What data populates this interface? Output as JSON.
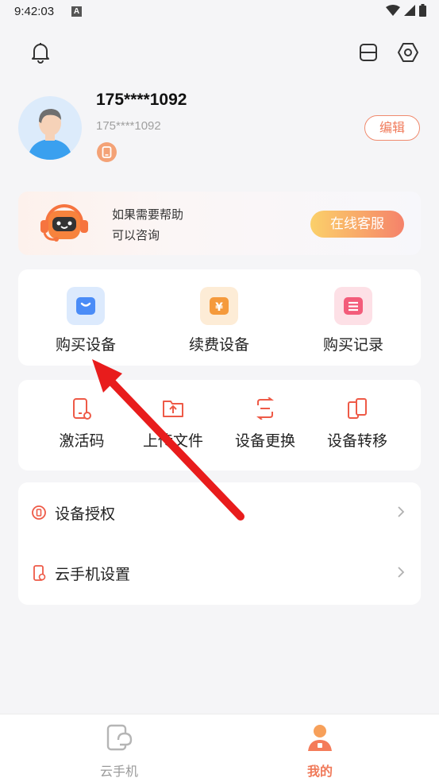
{
  "status": {
    "time": "9:42:03",
    "notif_letter": "A"
  },
  "header": {
    "icons": [
      "bell-icon",
      "scan-icon",
      "settings-icon"
    ]
  },
  "profile": {
    "name": "175****1092",
    "phone": "175****1092",
    "edit_label": "编辑"
  },
  "help": {
    "line1": "如果需要帮助",
    "line2": "可以咨询",
    "button": "在线客服"
  },
  "grid1": [
    {
      "label": "购买设备",
      "icon": "bag-icon",
      "color": "#4a8cf7"
    },
    {
      "label": "续费设备",
      "icon": "yuan-icon",
      "color": "#f59a3c"
    },
    {
      "label": "购买记录",
      "icon": "list-icon",
      "color": "#f35c7a"
    }
  ],
  "grid2": [
    {
      "label": "激活码",
      "icon": "activation-code-icon"
    },
    {
      "label": "上传文件",
      "icon": "upload-folder-icon"
    },
    {
      "label": "设备更换",
      "icon": "swap-device-icon"
    },
    {
      "label": "设备转移",
      "icon": "transfer-device-icon"
    }
  ],
  "list": [
    {
      "label": "设备授权",
      "icon": "authorize-icon"
    },
    {
      "label": "云手机设置",
      "icon": "phone-settings-icon"
    }
  ],
  "tabs": [
    {
      "label": "云手机",
      "active": false
    },
    {
      "label": "我的",
      "active": true
    }
  ],
  "colors": {
    "accent": "#f07a5a",
    "arrow": "#e81c1c",
    "active_tab": "#f07a5a"
  }
}
